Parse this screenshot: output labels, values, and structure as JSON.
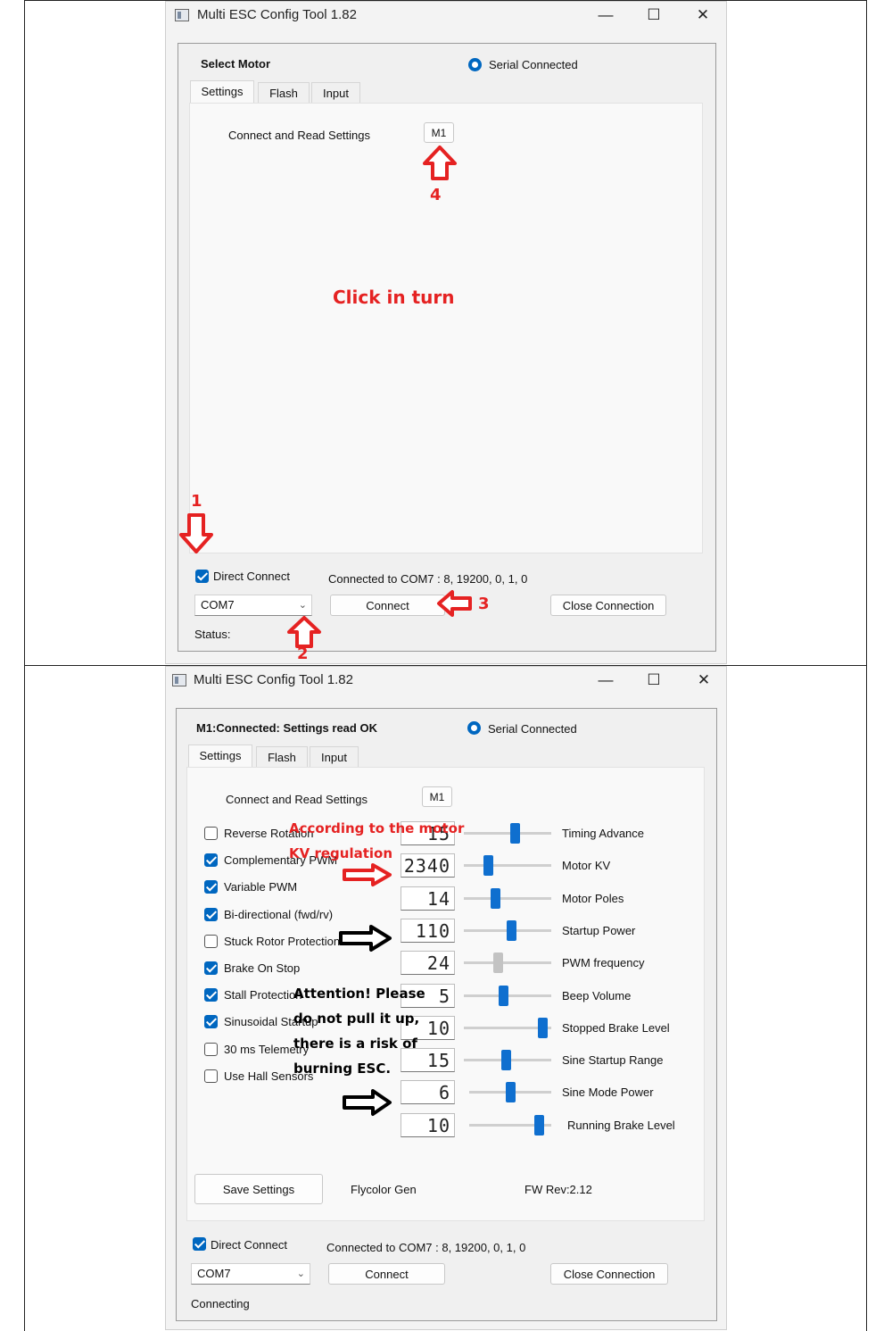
{
  "top": {
    "window_title": "Multi ESC Config Tool 1.82",
    "controls": {
      "minimize": "—",
      "maximize": "☐",
      "close": "✕"
    },
    "panel_title": "Select Motor",
    "serial_label": "Serial Connected",
    "tabs": [
      {
        "label": "Settings"
      },
      {
        "label": "Flash"
      },
      {
        "label": "Input"
      }
    ],
    "connect_read_label": "Connect and Read Settings",
    "motor_button": "M1",
    "direct_connect_label": "Direct Connect",
    "direct_connect_checked": true,
    "connected_info": "Connected to COM7 : 8, 19200, 0, 1, 0",
    "port_value": "COM7",
    "connect_button": "Connect",
    "close_button": "Close Connection",
    "status_label": "Status:",
    "annotations": {
      "click_in_turn": "Click in turn",
      "step1": "1",
      "step2": "2",
      "step3": "3",
      "step4": "4"
    }
  },
  "bottom": {
    "window_title": "Multi ESC Config Tool 1.82",
    "controls": {
      "minimize": "—",
      "maximize": "☐",
      "close": "✕"
    },
    "panel_title": "M1:Connected: Settings read OK",
    "serial_label": "Serial Connected",
    "tabs": [
      {
        "label": "Settings"
      },
      {
        "label": "Flash"
      },
      {
        "label": "Input"
      }
    ],
    "connect_read_label": "Connect and Read Settings",
    "motor_button": "M1",
    "checkboxes": [
      {
        "label": "Reverse Rotation",
        "checked": false
      },
      {
        "label": "Complementary PWM",
        "checked": true
      },
      {
        "label": "Variable PWM",
        "checked": true
      },
      {
        "label": "Bi-directional (fwd/rv)",
        "checked": true
      },
      {
        "label": "Stuck Rotor Protection",
        "checked": false
      },
      {
        "label": "Brake On Stop",
        "checked": true
      },
      {
        "label": "Stall Protection",
        "checked": true
      },
      {
        "label": "Sinusoidal Startup",
        "checked": true
      },
      {
        "label": "30 ms Telemetry",
        "checked": false
      },
      {
        "label": "Use Hall Sensors",
        "checked": false
      }
    ],
    "params": [
      {
        "label": "Timing Advance",
        "value": "15",
        "level": 0.6,
        "enabled": true
      },
      {
        "label": "Motor KV",
        "value": "2340",
        "level": 0.25,
        "enabled": true
      },
      {
        "label": "Motor Poles",
        "value": "14",
        "level": 0.35,
        "enabled": true
      },
      {
        "label": "Startup Power",
        "value": "110",
        "level": 0.55,
        "enabled": true
      },
      {
        "label": "PWM frequency",
        "value": "24",
        "level": 0.38,
        "enabled": false
      },
      {
        "label": "Beep Volume",
        "value": "5",
        "level": 0.45,
        "enabled": true
      },
      {
        "label": "Stopped Brake Level",
        "value": "10",
        "level": 0.95,
        "enabled": true
      },
      {
        "label": "Sine Startup Range",
        "value": "15",
        "level": 0.48,
        "enabled": true
      },
      {
        "label": "Sine Mode Power",
        "value": "6",
        "level": 0.5,
        "enabled": true
      },
      {
        "label": "Running Brake Level",
        "value": "10",
        "level": 0.9,
        "enabled": true
      }
    ],
    "save_button": "Save Settings",
    "firmware_name": "Flycolor Gen",
    "fw_rev": "FW Rev:2.12",
    "direct_connect_label": "Direct Connect",
    "direct_connect_checked": true,
    "connected_info": "Connected to COM7 : 8, 19200, 0, 1, 0",
    "port_value": "COM7",
    "connect_button": "Connect",
    "close_button": "Close Connection",
    "status_label": "Connecting",
    "annotations": {
      "kv_line1": "According to the motor",
      "kv_line2": "KV regulation",
      "warn_line1": "Attention! Please",
      "warn_line2": "do not pull it up,",
      "warn_line3": "there is a risk of",
      "warn_line4": "burning ESC."
    }
  },
  "colors": {
    "accent": "#0067c0",
    "annotation_red": "#e52222",
    "annotation_black": "#000000"
  }
}
